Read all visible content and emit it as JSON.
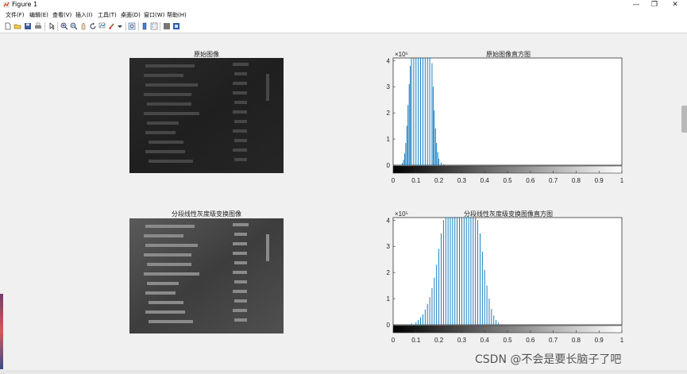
{
  "window": {
    "title": "Figure 1",
    "minimize": "—",
    "maximize": "❐",
    "close": "✕"
  },
  "menu": [
    {
      "label": "文件(F)"
    },
    {
      "label": "编辑(E)"
    },
    {
      "label": "查看(V)"
    },
    {
      "label": "插入(I)"
    },
    {
      "label": "工具(T)"
    },
    {
      "label": "桌面(D)"
    },
    {
      "label": "窗口(W)"
    },
    {
      "label": "帮助(H)"
    }
  ],
  "toolbar": {
    "icons": [
      "new-figure-icon",
      "open-icon",
      "save-icon",
      "print-icon",
      "pointer-icon",
      "zoom-in-icon",
      "zoom-out-icon",
      "pan-icon",
      "rotate-icon",
      "data-cursor-icon",
      "brush-icon",
      "link-icon",
      "colorbar-icon",
      "legend-icon",
      "hide-plot-tools-icon",
      "show-plot-tools-icon"
    ]
  },
  "panels": {
    "orig_image_title": "原始图像",
    "orig_hist_title": "原始图像直方图",
    "trans_image_title": "分段线性灰度级变换图像",
    "trans_hist_title": "分段线性灰度级变换图像直方图"
  },
  "chart_data": [
    {
      "type": "bar",
      "title": "原始图像直方图",
      "ylim": [
        0,
        410000
      ],
      "y_ticks": [
        0,
        1,
        2,
        3,
        4
      ],
      "y_exponent": "×10⁵",
      "xlim": [
        0,
        1
      ],
      "x_ticks": [
        "0",
        "0.1",
        "0.2",
        "0.3",
        "0.4",
        "0.5",
        "0.6",
        "0.7",
        "0.8",
        "0.9",
        "1"
      ],
      "colorbar": "gray",
      "bar_color": "#0072bd",
      "bars": [
        [
          0.03,
          2000
        ],
        [
          0.04,
          8000
        ],
        [
          0.045,
          20000
        ],
        [
          0.05,
          45000
        ],
        [
          0.055,
          85000
        ],
        [
          0.06,
          150000
        ],
        [
          0.065,
          230000
        ],
        [
          0.07,
          310000
        ],
        [
          0.075,
          380000
        ],
        [
          0.08,
          410000
        ],
        [
          0.09,
          410000
        ],
        [
          0.1,
          410000
        ],
        [
          0.11,
          410000
        ],
        [
          0.12,
          410000
        ],
        [
          0.13,
          410000
        ],
        [
          0.14,
          410000
        ],
        [
          0.15,
          410000
        ],
        [
          0.16,
          410000
        ],
        [
          0.17,
          390000
        ],
        [
          0.175,
          300000
        ],
        [
          0.18,
          210000
        ],
        [
          0.185,
          140000
        ],
        [
          0.19,
          85000
        ],
        [
          0.195,
          50000
        ],
        [
          0.2,
          25000
        ],
        [
          0.21,
          10000
        ],
        [
          0.22,
          3000
        ]
      ]
    },
    {
      "type": "bar",
      "title": "分段线性灰度级变换图像直方图",
      "ylim": [
        0,
        410000
      ],
      "y_ticks": [
        0,
        1,
        2,
        3,
        4
      ],
      "y_exponent": "×10⁵",
      "xlim": [
        0,
        1
      ],
      "x_ticks": [
        "0",
        "0.1",
        "0.2",
        "0.3",
        "0.4",
        "0.5",
        "0.6",
        "0.7",
        "0.8",
        "0.9",
        "1"
      ],
      "colorbar": "gray",
      "bar_color": "#0072bd",
      "bars": [
        [
          0.06,
          2000
        ],
        [
          0.08,
          5000
        ],
        [
          0.1,
          10000
        ],
        [
          0.11,
          18000
        ],
        [
          0.12,
          28000
        ],
        [
          0.13,
          40000
        ],
        [
          0.14,
          58000
        ],
        [
          0.15,
          80000
        ],
        [
          0.16,
          105000
        ],
        [
          0.17,
          140000
        ],
        [
          0.18,
          180000
        ],
        [
          0.19,
          230000
        ],
        [
          0.2,
          290000
        ],
        [
          0.21,
          350000
        ],
        [
          0.22,
          400000
        ],
        [
          0.23,
          410000
        ],
        [
          0.24,
          410000
        ],
        [
          0.25,
          410000
        ],
        [
          0.26,
          410000
        ],
        [
          0.27,
          410000
        ],
        [
          0.28,
          410000
        ],
        [
          0.29,
          410000
        ],
        [
          0.3,
          410000
        ],
        [
          0.31,
          410000
        ],
        [
          0.32,
          410000
        ],
        [
          0.33,
          410000
        ],
        [
          0.34,
          410000
        ],
        [
          0.35,
          410000
        ],
        [
          0.36,
          410000
        ],
        [
          0.37,
          400000
        ],
        [
          0.38,
          350000
        ],
        [
          0.39,
          280000
        ],
        [
          0.4,
          210000
        ],
        [
          0.41,
          150000
        ],
        [
          0.42,
          100000
        ],
        [
          0.43,
          60000
        ],
        [
          0.44,
          35000
        ],
        [
          0.45,
          18000
        ],
        [
          0.46,
          8000
        ],
        [
          0.48,
          2000
        ]
      ]
    }
  ],
  "watermark": "CSDN @不会是要长脑子了吧"
}
